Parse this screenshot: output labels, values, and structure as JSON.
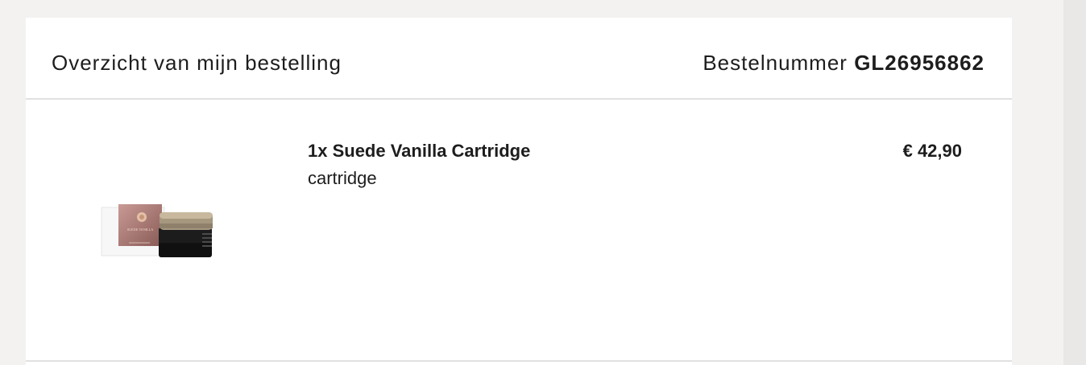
{
  "order": {
    "overview_title": "Overzicht van mijn bestelling",
    "order_number_label": "Bestelnummer",
    "order_number": "GL26956862"
  },
  "items": [
    {
      "name": "1x Suede Vanilla Cartridge",
      "variant": "cartridge",
      "price": "€ 42,90",
      "image_icon": "product-cartridge-image",
      "image_text": "SUEDE VANILLA"
    }
  ]
}
